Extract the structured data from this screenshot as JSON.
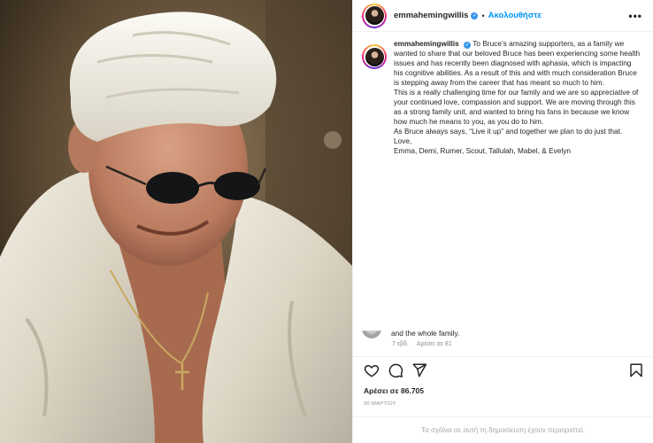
{
  "header": {
    "username": "emmahemingwillis",
    "follow_label": "Ακολουθήστε",
    "dot": "•",
    "more_label": "•••"
  },
  "caption": {
    "username": "emmahemingwillis",
    "paragraphs": [
      "To Bruce’s amazing supporters, as a family we wanted to share that our beloved Bruce has been experiencing some health issues and has recently been diagnosed with aphasia, which is impacting his cognitive abilities. As a result of this and with much consideration Bruce is stepping away from the career that has meant so much to him.",
      "This is a really challenging time for our family and we are so appreciative of your continued love, compassion and support. We are moving through this as a strong family unit, and wanted to bring his fans in because we know how much he means to you, as you do to him.",
      "As Bruce always says, “Live it up” and together we plan to do just that.",
      "Love,",
      "Emma, Demi, Rumer, Scout, Tallulah, Mabel, & Evelyn"
    ]
  },
  "reply": {
    "text": "and the whole family.",
    "age": "7 εβδ.",
    "likes": "Αρέσει σε 81"
  },
  "actions": {
    "icons": [
      "heart-icon",
      "comment-icon",
      "share-icon",
      "bookmark-icon"
    ]
  },
  "post": {
    "likes_label": "Αρέσει σε 86.705",
    "date": "30 ΜΑΡΤΙΟΥ"
  },
  "footer": {
    "restricted_text": "Τα σχόλια σε αυτή τη δημοσίευση έχουν περιοριστεί."
  },
  "colors": {
    "accent": "#0095f6",
    "verified": "#3897f0",
    "muted": "#8e8e8e",
    "text": "#262626"
  }
}
